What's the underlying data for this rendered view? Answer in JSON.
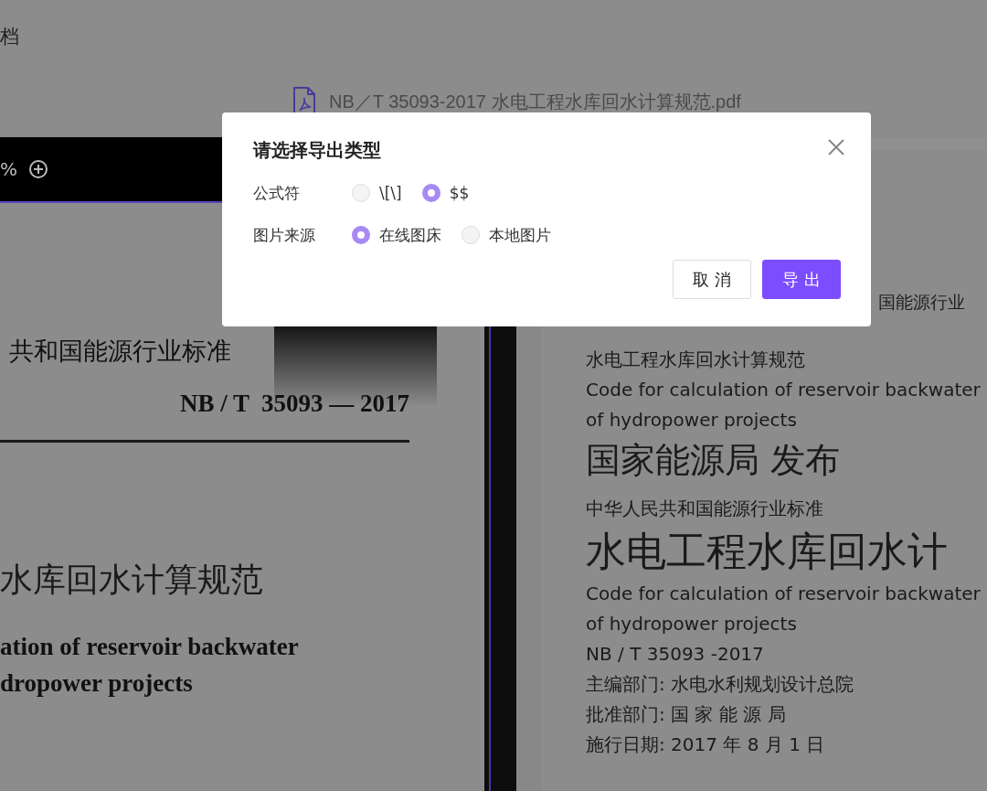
{
  "header": {
    "title": "档"
  },
  "file": {
    "name": "NB／T 35093-2017 水电工程水库回水计算规范.pdf"
  },
  "viewer": {
    "zoom": "%"
  },
  "left_page": {
    "standard_line": "共和国能源行业标准",
    "code": "NB / T  35093 — 2017",
    "title": "水库回水计算规范",
    "english": [
      "ation of reservoir backwater",
      "dropower projects"
    ]
  },
  "preview": {
    "covered_line": "国能源行业",
    "lines": [
      {
        "text": "水电工程水库回水计算规范",
        "kind": "body"
      },
      {
        "text": "Code for calculation of reservoir backwater",
        "kind": "body"
      },
      {
        "text": "of hydropower projects",
        "kind": "body"
      },
      {
        "text": "国家能源局 发布",
        "kind": "heading"
      },
      {
        "text": "中华人民共和国能源行业标准",
        "kind": "spaced"
      },
      {
        "text": "水电工程水库回水计",
        "kind": "title"
      },
      {
        "text": "Code for calculation of reservoir backwater",
        "kind": "body"
      },
      {
        "text": "of hydropower projects",
        "kind": "body"
      },
      {
        "text": "NB / T 35093 -2017",
        "kind": "body"
      },
      {
        "text": "主编部门: 水电水利规划设计总院",
        "kind": "body"
      },
      {
        "text": "批准部门: 国 家 能 源 局",
        "kind": "body"
      },
      {
        "text": "施行日期: 2017 年 8 月 1 日",
        "kind": "body"
      }
    ]
  },
  "dialog": {
    "title": "请选择导出类型",
    "groups": [
      {
        "label": "公式符",
        "options": [
          {
            "label": "\\[\\]",
            "selected": false
          },
          {
            "label": "$$",
            "selected": true
          }
        ]
      },
      {
        "label": "图片来源",
        "options": [
          {
            "label": "在线图床",
            "selected": true
          },
          {
            "label": "本地图片",
            "selected": false
          }
        ]
      }
    ],
    "buttons": [
      {
        "label": "取 消",
        "kind": "secondary"
      },
      {
        "label": "导 出",
        "kind": "primary"
      }
    ]
  }
}
